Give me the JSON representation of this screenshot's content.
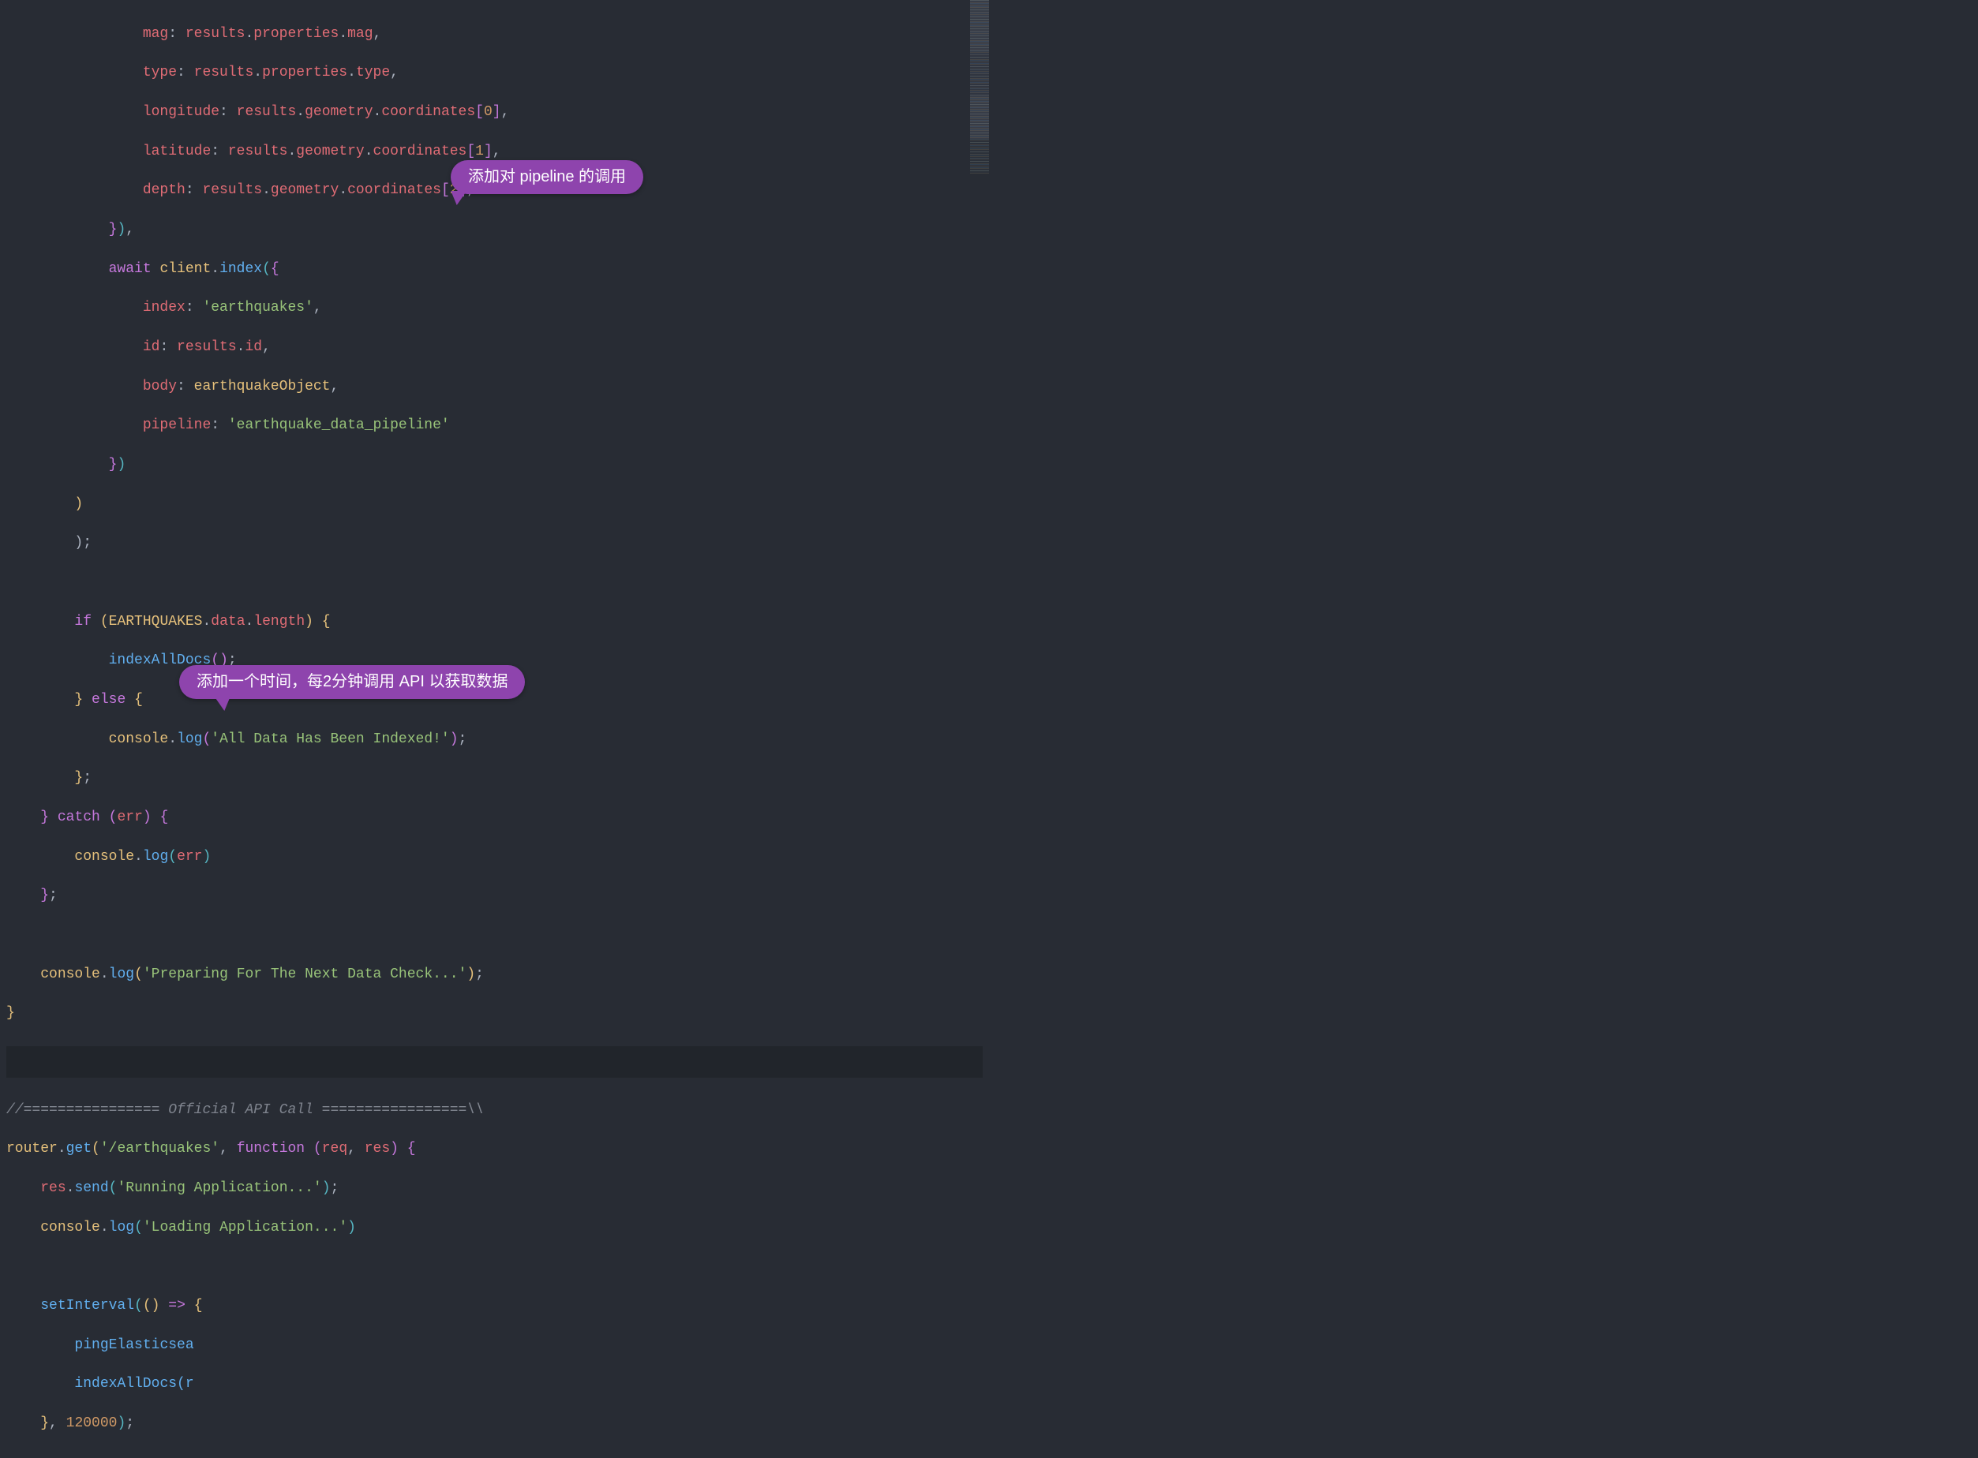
{
  "callouts": {
    "c1": "添加对 pipeline 的调用",
    "c2": "添加一个时间，每2分钟调用 API 以获取数据"
  },
  "code": {
    "props": {
      "mag": "mag",
      "type": "type",
      "longitude": "longitude",
      "latitude": "latitude",
      "depth": "depth"
    },
    "expr": {
      "results": "results",
      "properties": "properties",
      "geometry": "geometry",
      "coordinates": "coordinates",
      "data": "data",
      "length": "length",
      "id": "id"
    },
    "idx": {
      "zero": "0",
      "one": "1",
      "two": "2"
    },
    "kw": {
      "await": "await",
      "if": "if",
      "else": "else",
      "catch": "catch",
      "function": "function",
      "arrow": "=>"
    },
    "ident": {
      "client": "client",
      "earthquakeObject": "earthquakeObject",
      "EARTHQUAKES": "EARTHQUAKES",
      "console": "console",
      "err": "err",
      "router": "router",
      "req": "req",
      "res": "res",
      "setInterval": "setInterval",
      "pingElasticsea": "pingElasticsea",
      "indexAllDocs_trunc": "indexAllDocs(r",
      "indexAllDocs": "indexAllDocs"
    },
    "method": {
      "index": "index",
      "log": "log",
      "get": "get",
      "send": "send"
    },
    "str": {
      "earthquakes_idx": "'earthquakes'",
      "pipeline_name": "'earthquake_data_pipeline'",
      "allIndexed": "'All Data Has Been Indexed!'",
      "preparing": "'Preparing For The Next Data Check...'",
      "route": "'/earthquakes'",
      "running": "'Running Application...'",
      "loading": "'Loading Application...'"
    },
    "opts": {
      "index": "index",
      "idKey": "id",
      "body": "body",
      "pipeline": "pipeline"
    },
    "num": {
      "interval": "120000"
    },
    "comment": {
      "official": "//================ Official API Call =================\\\\"
    }
  }
}
